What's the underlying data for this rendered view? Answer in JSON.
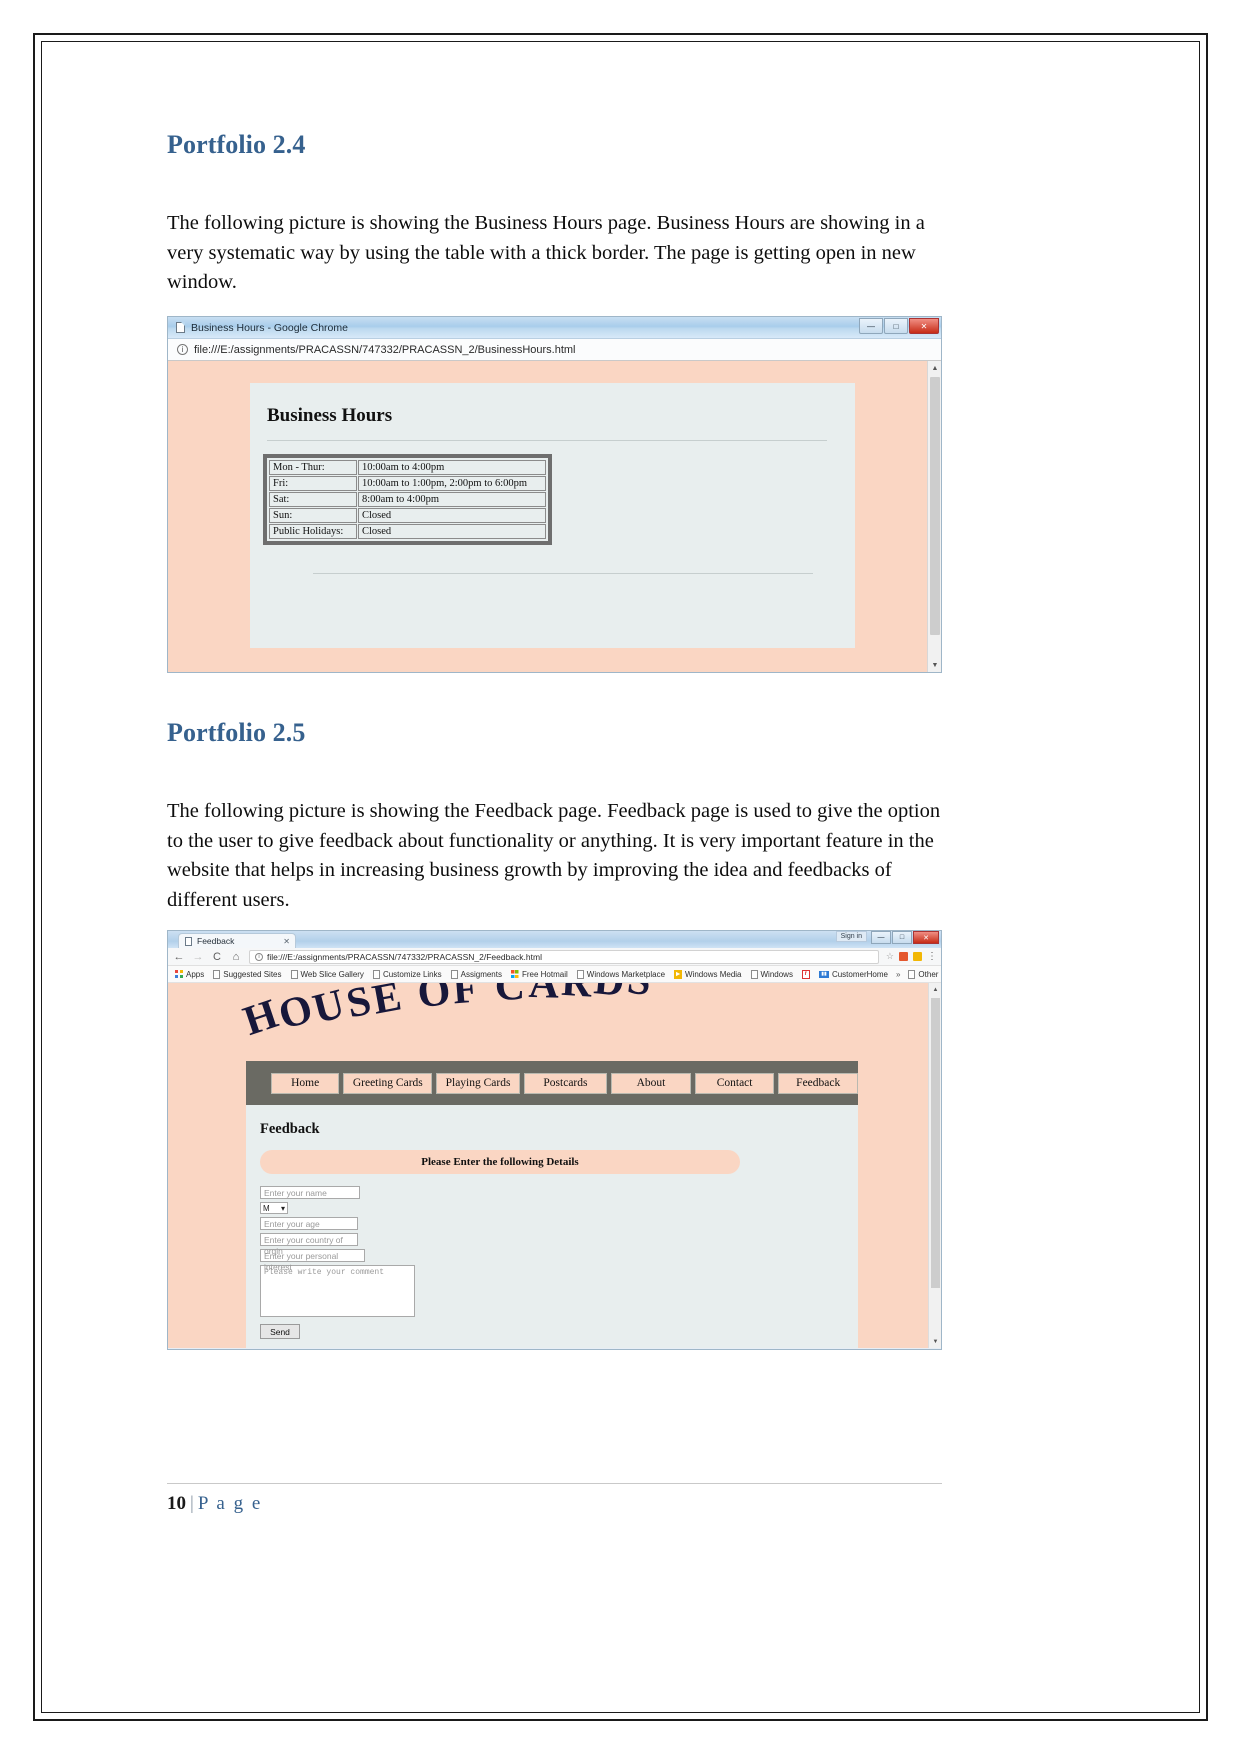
{
  "document": {
    "sections": [
      {
        "heading": "Portfolio 2.4",
        "body": "The following picture is showing the Business Hours page. Business Hours are showing in a very systematic way by using the table with a thick border. The page is getting open in new window."
      },
      {
        "heading": "Portfolio 2.5",
        "body": "The following picture is showing the Feedback page. Feedback page is used to give the option to the user to give feedback about functionality or anything. It is very important feature in the website that helps in increasing business growth by improving the idea and feedbacks of different users."
      }
    ],
    "footer": {
      "page_number": "10",
      "separator": "|",
      "label": "P a g e"
    }
  },
  "screenshot_business_hours": {
    "window_title": "Business Hours - Google Chrome",
    "window_controls": {
      "minimize": "—",
      "maximize": "□",
      "close": "✕"
    },
    "url": "file:///E:/assignments/PRACASSN/747332/PRACASSN_2/BusinessHours.html",
    "info_icon": "ⓘ",
    "page": {
      "title": "Business Hours",
      "table": {
        "rows": [
          {
            "day": "Mon - Thur:",
            "hours": "10:00am to 4:00pm"
          },
          {
            "day": "Fri:",
            "hours": "10:00am to 1:00pm, 2:00pm to 6:00pm"
          },
          {
            "day": "Sat:",
            "hours": "8:00am to 4:00pm"
          },
          {
            "day": "Sun:",
            "hours": "Closed"
          },
          {
            "day": "Public Holidays:",
            "hours": "Closed"
          }
        ]
      }
    },
    "scrollbar": {
      "up": "▲",
      "down": "▼"
    }
  },
  "screenshot_feedback": {
    "tab_label": "Feedback",
    "tab_close": "✕",
    "window_controls": {
      "signin": "Sign in",
      "minimize": "—",
      "maximize": "□",
      "close": "✕"
    },
    "nav": {
      "back": "←",
      "forward": "→",
      "reload": "C",
      "home": "⌂"
    },
    "url": "file:///E:/assignments/PRACASSN/747332/PRACASSN_2/Feedback.html",
    "info_icon": "ⓘ",
    "star_icon": "☆",
    "menu_icon": "⋮",
    "bookmarks": [
      {
        "label": "Apps",
        "icon": "apps-grid-icon"
      },
      {
        "label": "Suggested Sites",
        "icon": "page-icon"
      },
      {
        "label": "Web Slice Gallery",
        "icon": "page-icon"
      },
      {
        "label": "Customize Links",
        "icon": "page-icon"
      },
      {
        "label": "Assigments",
        "icon": "page-icon"
      },
      {
        "label": "Free Hotmail",
        "icon": "windows-icon"
      },
      {
        "label": "Windows Marketplace",
        "icon": "page-icon"
      },
      {
        "label": "Windows Media",
        "icon": "media-icon"
      },
      {
        "label": "Windows",
        "icon": "page-icon"
      },
      {
        "label": "",
        "icon": "red-r-icon"
      },
      {
        "label": "CustomerHome",
        "icon": "customer-icon"
      }
    ],
    "bookmarks_overflow": "»",
    "other_bookmarks": "Other bookmarks",
    "site": {
      "brand": "HOUSE OF CARDS",
      "nav_items": [
        "Home",
        "Greeting Cards",
        "Playing Cards",
        "Postcards",
        "About",
        "Contact",
        "Feedback"
      ],
      "page_title": "Feedback",
      "form_banner": "Please Enter the following Details",
      "fields": [
        {
          "name": "name-field",
          "placeholder": "Enter your name"
        },
        {
          "name": "gender-select",
          "value": "M",
          "caret": "▾"
        },
        {
          "name": "age-field",
          "placeholder": "Enter your age"
        },
        {
          "name": "country-field",
          "placeholder": "Enter your country of orgin"
        },
        {
          "name": "interest-field",
          "placeholder": "Enter your personal interest"
        }
      ],
      "comment_placeholder": "Please write your comment",
      "submit_label": "Send"
    },
    "scrollbar": {
      "up": "▲",
      "down": "▼"
    }
  },
  "colors": {
    "heading_blue": "#36618e",
    "site_peach": "#fad6c3",
    "site_grey": "#6a6a63",
    "site_panel": "#e8eeee"
  }
}
